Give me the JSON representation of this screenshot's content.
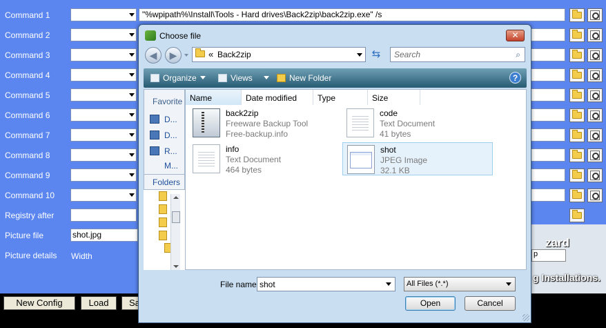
{
  "config": {
    "rows": [
      {
        "label": "Command 1"
      },
      {
        "label": "Command 2"
      },
      {
        "label": "Command 3"
      },
      {
        "label": "Command 4"
      },
      {
        "label": "Command 5"
      },
      {
        "label": "Command 6"
      },
      {
        "label": "Command 7"
      },
      {
        "label": "Command 8"
      },
      {
        "label": "Command 9"
      },
      {
        "label": "Command 10"
      }
    ],
    "command1_value": "\"%wpipath%\\Install\\Tools - Hard drives\\Back2zip\\back2zip.exe\" /s",
    "registry_label": "Registry after",
    "picture_file_label": "Picture file",
    "picture_file_value": "shot.jpg",
    "picture_details_label": "Picture details",
    "width_label": "Width",
    "buttons": {
      "new_config": "New Config",
      "load": "Load",
      "save_partial": "Sa"
    },
    "banner_zard": "zard",
    "banner_combo": "p",
    "banner_text": "g Installations."
  },
  "dialog": {
    "title": "Choose file",
    "close_glyph": "✕",
    "address_chevron": "«",
    "address_path": "Back2zip",
    "search_placeholder": "Search",
    "toolbar": {
      "organize": "Organize",
      "views": "Views",
      "new_folder": "New Folder",
      "help": "?"
    },
    "nav": {
      "favorites_header": "Favorite",
      "links": [
        "D...",
        "D...",
        "R...",
        "M..."
      ],
      "folders_header": "Folders"
    },
    "columns": [
      "Name",
      "Date modified",
      "Type",
      "Size"
    ],
    "files": [
      {
        "name": "back2zip",
        "line1": "Freeware Backup Tool",
        "line2": "Free-backup.info",
        "icon": "zip-archive-icon"
      },
      {
        "name": "code",
        "line1": "Text Document",
        "line2": "41 bytes",
        "icon": "text-document-icon"
      },
      {
        "name": "info",
        "line1": "Text Document",
        "line2": "464 bytes",
        "icon": "text-document-icon"
      },
      {
        "name": "shot",
        "line1": "JPEG Image",
        "line2": "32.1 KB",
        "icon": "jpeg-image-icon"
      }
    ],
    "file_name_label": "File name:",
    "file_name_value": "shot",
    "filter_value": "All Files (*.*)",
    "open_label": "Open",
    "cancel_label": "Cancel"
  }
}
